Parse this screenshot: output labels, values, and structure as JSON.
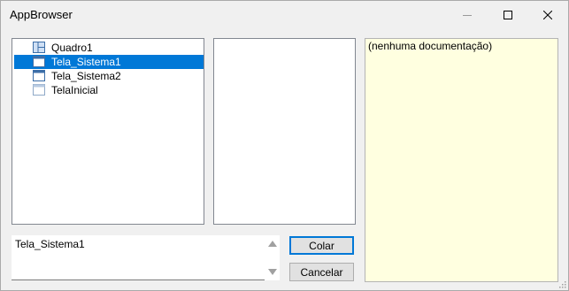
{
  "window": {
    "title": "AppBrowser"
  },
  "tree": {
    "items": [
      {
        "label": "Quadro1",
        "icon": "frame-icon",
        "selected": false
      },
      {
        "label": "Tela_Sistema1",
        "icon": "window-icon",
        "selected": true
      },
      {
        "label": "Tela_Sistema2",
        "icon": "window-icon",
        "selected": false
      },
      {
        "label": "TelaInicial",
        "icon": "window-icon-light",
        "selected": false
      }
    ]
  },
  "documentation": {
    "text": "(nenhuma documentação)"
  },
  "selection": {
    "value": "Tela_Sistema1"
  },
  "buttons": {
    "colar": "Colar",
    "cancelar": "Cancelar"
  },
  "colors": {
    "selection": "#0078d7",
    "doc_background": "#ffffe0"
  }
}
